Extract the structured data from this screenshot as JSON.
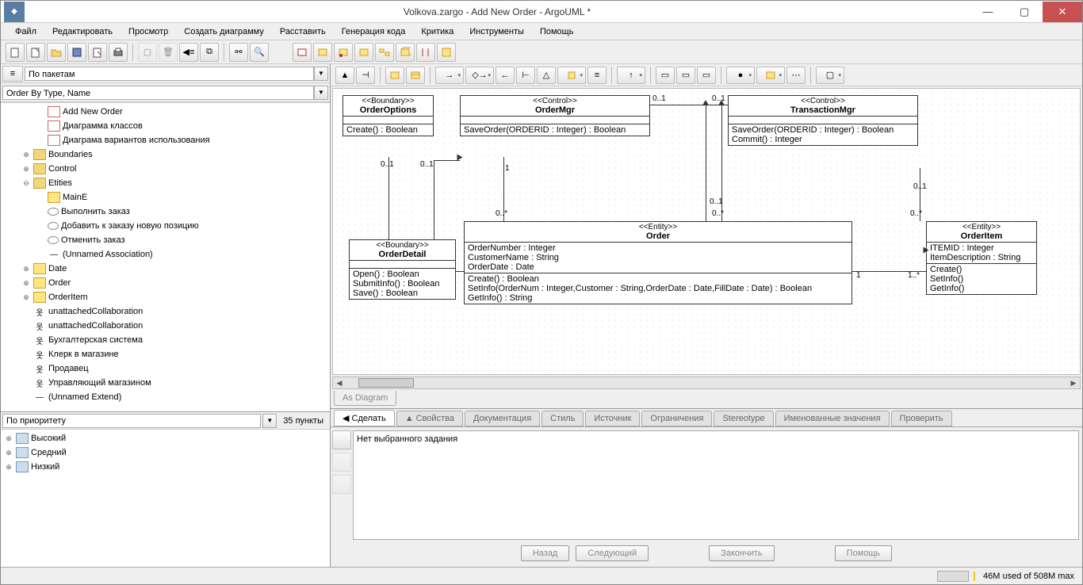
{
  "title": "Volkova.zargo - Add New Order - ArgoUML *",
  "menu": [
    "Файл",
    "Редактировать",
    "Просмотр",
    "Создать диаграмму",
    "Расставить",
    "Генерация кода",
    "Критика",
    "Инструменты",
    "Помощь"
  ],
  "explorer": {
    "perspective": "По пакетам",
    "order": "Order By Type, Name",
    "items": [
      {
        "indent": 2,
        "toggle": "",
        "icon": "diag",
        "label": "Add New Order"
      },
      {
        "indent": 2,
        "toggle": "",
        "icon": "diag",
        "label": "Диаграмма классов"
      },
      {
        "indent": 2,
        "toggle": "",
        "icon": "diag",
        "label": "Диаграма вариантов использования"
      },
      {
        "indent": 1,
        "toggle": "⊕",
        "icon": "folder",
        "label": "Boundaries"
      },
      {
        "indent": 1,
        "toggle": "⊕",
        "icon": "folder",
        "label": "Control"
      },
      {
        "indent": 1,
        "toggle": "⊖",
        "icon": "folder",
        "label": "Etities"
      },
      {
        "indent": 2,
        "toggle": "",
        "icon": "class",
        "label": "MainE"
      },
      {
        "indent": 2,
        "toggle": "",
        "icon": "usecase",
        "label": "Выполнить заказ"
      },
      {
        "indent": 2,
        "toggle": "",
        "icon": "usecase",
        "label": "Добавить к заказу новую позицию"
      },
      {
        "indent": 2,
        "toggle": "",
        "icon": "usecase",
        "label": "Отменить заказ"
      },
      {
        "indent": 2,
        "toggle": "",
        "icon": "line",
        "label": "(Unnamed Association)"
      },
      {
        "indent": 1,
        "toggle": "⊕",
        "icon": "class",
        "label": "Date"
      },
      {
        "indent": 1,
        "toggle": "⊕",
        "icon": "class",
        "label": "Order"
      },
      {
        "indent": 1,
        "toggle": "⊕",
        "icon": "class",
        "label": "OrderItem"
      },
      {
        "indent": 1,
        "toggle": "",
        "icon": "actor",
        "label": "unattachedCollaboration"
      },
      {
        "indent": 1,
        "toggle": "",
        "icon": "actor",
        "label": "unattachedCollaboration"
      },
      {
        "indent": 1,
        "toggle": "",
        "icon": "actor",
        "label": "Бухгалтерская система"
      },
      {
        "indent": 1,
        "toggle": "",
        "icon": "actor",
        "label": "Клерк в магазине"
      },
      {
        "indent": 1,
        "toggle": "",
        "icon": "actor",
        "label": "Продавец"
      },
      {
        "indent": 1,
        "toggle": "",
        "icon": "actor",
        "label": "Управляющий магазином"
      },
      {
        "indent": 1,
        "toggle": "",
        "icon": "line",
        "label": "(Unnamed Extend)"
      }
    ]
  },
  "todo": {
    "label": "По приоритету",
    "count": "35 пункты",
    "groups": [
      "Высокий",
      "Средний",
      "Низкий"
    ]
  },
  "diagram": {
    "tab": "As Diagram",
    "classes": {
      "orderOptions": {
        "stereo": "<<Boundary>>",
        "name": "OrderOptions",
        "ops": [
          "Create() : Boolean"
        ]
      },
      "orderMgr": {
        "stereo": "<<Control>>",
        "name": "OrderMgr",
        "ops": [
          "SaveOrder(ORDERID : Integer) : Boolean"
        ]
      },
      "transactionMgr": {
        "stereo": "<<Control>>",
        "name": "TransactionMgr",
        "ops": [
          "SaveOrder(ORDERID : Integer) : Boolean",
          "Commit() : Integer"
        ]
      },
      "orderDetail": {
        "stereo": "<<Boundary>>",
        "name": "OrderDetail",
        "ops": [
          "Open() : Boolean",
          "SubmitInfo() : Boolean",
          "Save() : Boolean"
        ]
      },
      "order": {
        "stereo": "<<Entity>>",
        "name": "Order",
        "attrs": [
          "OrderNumber : Integer",
          "CustomerName : String",
          "OrderDate : Date"
        ],
        "ops": [
          "Create() : Boolean",
          "SetInfo(OrderNum : Integer,Customer : String,OrderDate : Date,FillDate : Date) : Boolean",
          "GetInfo() : String"
        ]
      },
      "orderItem": {
        "stereo": "<<Entity>>",
        "name": "OrderItem",
        "attrs": [
          "ITEMID : Integer",
          "ItemDescription : String"
        ],
        "ops": [
          "Create()",
          "SetInfo()",
          "GetInfo()"
        ]
      }
    },
    "mults": {
      "m01a": "0..1",
      "m01b": "0..1",
      "m01c": "0..1",
      "m01d": "0..1",
      "m01e": "0..1",
      "m01f": "0..1",
      "m1": "1",
      "m0s": "0..*",
      "m0s2": "0..*",
      "m0s3": "0..*",
      "m1b": "1",
      "m1s": "1..*"
    }
  },
  "details": {
    "tabs": [
      "◀ Сделать",
      "▲ Свойства",
      "Документация",
      "Стиль",
      "Источник",
      "Ограничения",
      "Stereotype",
      "Именованные значения",
      "Проверить"
    ],
    "empty": "Нет выбранного задания",
    "buttons": {
      "back": "Назад",
      "next": "Следующий",
      "finish": "Закончить",
      "help": "Помощь"
    }
  },
  "status": {
    "mem": "46M used of 508M max"
  }
}
